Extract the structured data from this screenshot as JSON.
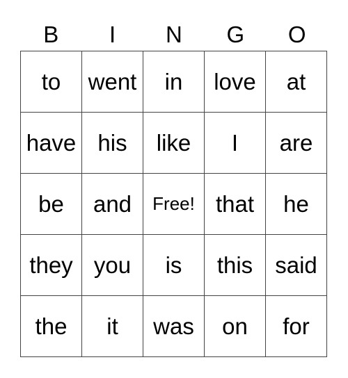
{
  "header": [
    "B",
    "I",
    "N",
    "G",
    "O"
  ],
  "grid": [
    [
      "to",
      "went",
      "in",
      "love",
      "at"
    ],
    [
      "have",
      "his",
      "like",
      "I",
      "are"
    ],
    [
      "be",
      "and",
      "Free!",
      "that",
      "he"
    ],
    [
      "they",
      "you",
      "is",
      "this",
      "said"
    ],
    [
      "the",
      "it",
      "was",
      "on",
      "for"
    ]
  ]
}
